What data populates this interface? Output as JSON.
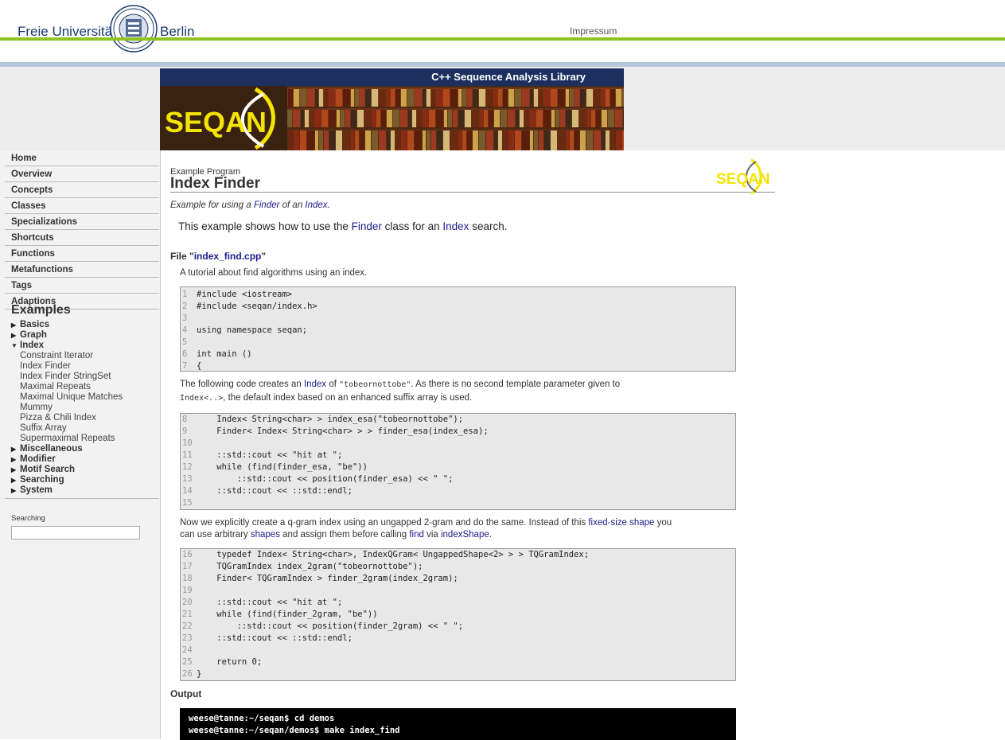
{
  "header": {
    "university_left": "Freie Universität",
    "university_right": "Berlin",
    "impressum": "Impressum",
    "green": "#8fc31f"
  },
  "banner": {
    "title": "C++ Sequence Analysis Library",
    "logo_text": "SEQAN",
    "bg": "#1c2f5e"
  },
  "nav": {
    "items": [
      "Home",
      "Overview",
      "Concepts",
      "Classes",
      "Specializations",
      "Shortcuts",
      "Functions",
      "Metafunctions",
      "Tags",
      "Adaptions"
    ],
    "examples_heading": "Examples",
    "categories": [
      {
        "label": "Basics",
        "expanded": false
      },
      {
        "label": "Graph",
        "expanded": false
      },
      {
        "label": "Index",
        "expanded": true,
        "children": [
          "Constraint Iterator",
          "Index Finder",
          "Index Finder StringSet",
          "Maximal Repeats",
          "Maximal Unique Matches",
          "Mummy",
          "Pizza & Chili Index",
          "Suffix Array",
          "Supermaximal Repeats"
        ]
      },
      {
        "label": "Miscellaneous",
        "expanded": false
      },
      {
        "label": "Modifier",
        "expanded": false
      },
      {
        "label": "Motif Search",
        "expanded": false
      },
      {
        "label": "Searching",
        "expanded": false
      },
      {
        "label": "System",
        "expanded": false
      }
    ],
    "search_label": "Searching",
    "search_value": ""
  },
  "content": {
    "program_label": "Example Program",
    "title": "Index Finder",
    "subtitle": {
      "pre": "Example for using a ",
      "link1": "Finder",
      "mid": " of an ",
      "link2": "Index",
      "post": "."
    },
    "intro": {
      "pre": "This example shows how to use the ",
      "link1": "Finder",
      "mid": " class for an ",
      "link2": "Index",
      "post": " search."
    },
    "file_heading": {
      "pre": "File \"",
      "file": "index_find.cpp",
      "post": "\""
    },
    "tutorial": "A tutorial about find algorithms using an index.",
    "code1": [
      {
        "n": "1",
        "t": "#include <iostream>"
      },
      {
        "n": "2",
        "t": "#include <seqan/index.h>"
      },
      {
        "n": "3",
        "t": ""
      },
      {
        "n": "4",
        "t": "using namespace seqan;"
      },
      {
        "n": "5",
        "t": ""
      },
      {
        "n": "6",
        "t": "int main ()"
      },
      {
        "n": "7",
        "t": "{"
      }
    ],
    "para1": {
      "p1": "The following code creates an ",
      "l1": "Index",
      "p2": " of ",
      "c1": "\"tobeornottobe\"",
      "p3": ". As there is no second template parameter given to",
      "c2": "Index<..>",
      "p4": ", the default index based on an enhanced suffix array is used."
    },
    "code2": [
      {
        "n": "8",
        "t": "    Index< String<char> > index_esa(\"tobeornottobe\");"
      },
      {
        "n": "9",
        "t": "    Finder< Index< String<char> > > finder_esa(index_esa);"
      },
      {
        "n": "10",
        "t": ""
      },
      {
        "n": "11",
        "t": "    ::std::cout << \"hit at \";"
      },
      {
        "n": "12",
        "t": "    while (find(finder_esa, \"be\"))"
      },
      {
        "n": "13",
        "t": "        ::std::cout << position(finder_esa) << \" \";"
      },
      {
        "n": "14",
        "t": "    ::std::cout << ::std::endl;"
      },
      {
        "n": "15",
        "t": ""
      }
    ],
    "para2": {
      "p1": "Now we explicitly create a q-gram index using an ungapped 2-gram and do the same. Instead of this ",
      "l1": "fixed-size shape",
      "p2": " you",
      "p3": "can use arbitrary ",
      "l2": "shapes",
      "p4": " and assign them before calling ",
      "l3": "find",
      "p5": " via ",
      "l4": "indexShape",
      "p6": "."
    },
    "code3": [
      {
        "n": "16",
        "t": "    typedef Index< String<char>, IndexQGram< UngappedShape<2> > > TQGramIndex;"
      },
      {
        "n": "17",
        "t": "    TQGramIndex index_2gram(\"tobeornottobe\");"
      },
      {
        "n": "18",
        "t": "    Finder< TQGramIndex > finder_2gram(index_2gram);"
      },
      {
        "n": "19",
        "t": ""
      },
      {
        "n": "20",
        "t": "    ::std::cout << \"hit at \";"
      },
      {
        "n": "21",
        "t": "    while (find(finder_2gram, \"be\"))"
      },
      {
        "n": "22",
        "t": "        ::std::cout << position(finder_2gram) << \" \";"
      },
      {
        "n": "23",
        "t": "    ::std::cout << ::std::endl;"
      },
      {
        "n": "24",
        "t": ""
      },
      {
        "n": "25",
        "t": "    return 0;"
      },
      {
        "n": "26",
        "t": "}"
      }
    ],
    "output_heading": "Output",
    "output_lines": [
      "weese@tanne:~/seqan$ cd demos",
      "weese@tanne:~/seqan/demos$ make index_find"
    ]
  }
}
